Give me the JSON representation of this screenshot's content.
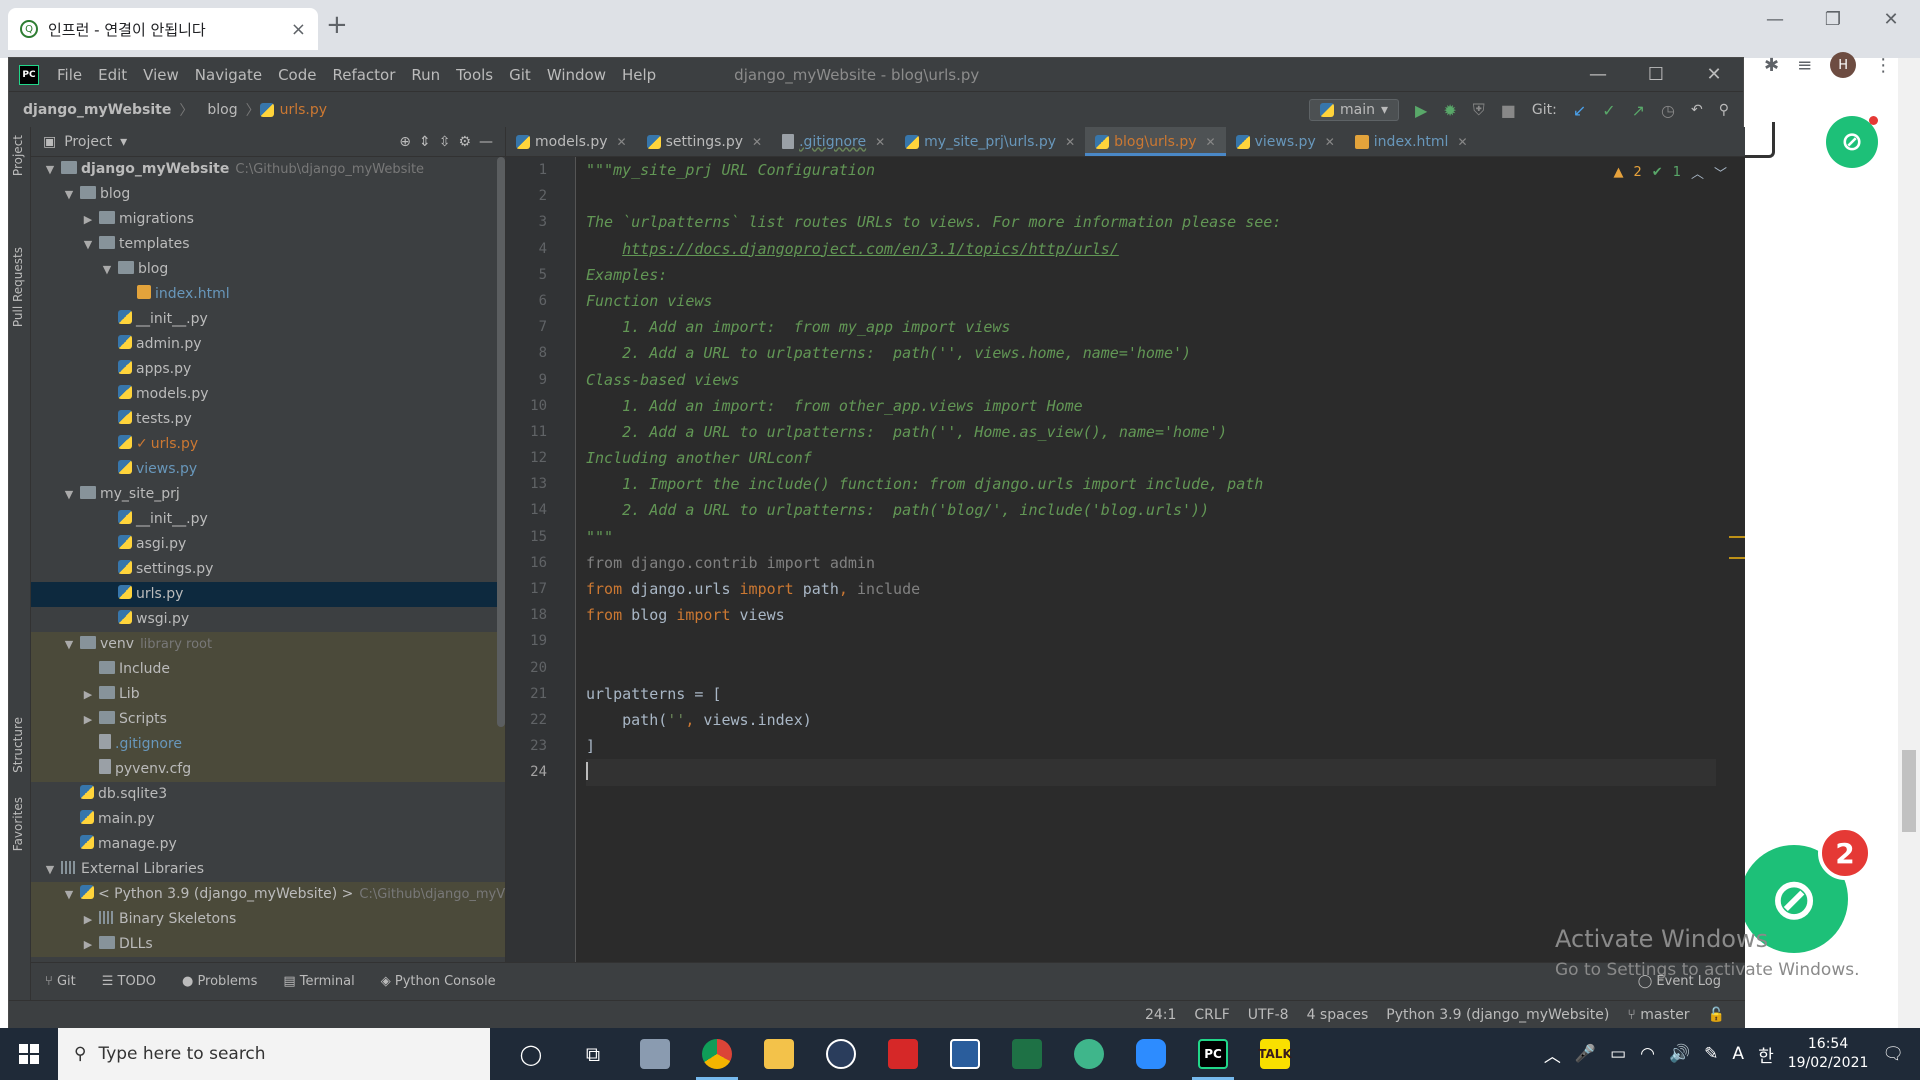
{
  "browser": {
    "tab_title": "인프런 - 연결이 안됩니다",
    "tab_close": "×",
    "new_tab": "+",
    "profile_initial": "H",
    "notif_count": "2",
    "watermark_line1": "Activate Windows",
    "watermark_line2": "Go to Settings to activate Windows."
  },
  "ide": {
    "menu": [
      "File",
      "Edit",
      "View",
      "Navigate",
      "Code",
      "Refactor",
      "Run",
      "Tools",
      "Git",
      "Window",
      "Help"
    ],
    "window_title": "django_myWebsite - blog\\urls.py",
    "breadcrumb": {
      "project": "django_myWebsite",
      "folder": "blog",
      "file": "urls.py"
    },
    "run_config": "main",
    "git_label": "Git:",
    "project_header": "Project",
    "left_strip": {
      "project": "Project",
      "pull_requests": "Pull Requests",
      "structure": "Structure",
      "favorites": "Favorites"
    },
    "tree": [
      {
        "label": "django_myWebsite",
        "extra": "C:\\Github\\django_myWebsite",
        "depth": 0,
        "arrow": "open",
        "icon": "folder",
        "bold": true
      },
      {
        "label": "blog",
        "depth": 1,
        "arrow": "open",
        "icon": "folder"
      },
      {
        "label": "migrations",
        "depth": 2,
        "arrow": "closed",
        "icon": "folder"
      },
      {
        "label": "templates",
        "depth": 2,
        "arrow": "open",
        "icon": "folder"
      },
      {
        "label": "blog",
        "depth": 3,
        "arrow": "open",
        "icon": "folder"
      },
      {
        "label": "index.html",
        "depth": 4,
        "icon": "html",
        "color": "blue"
      },
      {
        "label": "__init__.py",
        "depth": 3,
        "icon": "py"
      },
      {
        "label": "admin.py",
        "depth": 3,
        "icon": "py"
      },
      {
        "label": "apps.py",
        "depth": 3,
        "icon": "py"
      },
      {
        "label": "models.py",
        "depth": 3,
        "icon": "py"
      },
      {
        "label": "tests.py",
        "depth": 3,
        "icon": "py"
      },
      {
        "label": "urls.py",
        "depth": 3,
        "icon": "py",
        "color": "orange",
        "check": true
      },
      {
        "label": "views.py",
        "depth": 3,
        "icon": "py",
        "color": "blue"
      },
      {
        "label": "my_site_prj",
        "depth": 1,
        "arrow": "open",
        "icon": "folder"
      },
      {
        "label": "__init__.py",
        "depth": 3,
        "icon": "py"
      },
      {
        "label": "asgi.py",
        "depth": 3,
        "icon": "py"
      },
      {
        "label": "settings.py",
        "depth": 3,
        "icon": "py"
      },
      {
        "label": "urls.py",
        "depth": 3,
        "icon": "py",
        "selected": true
      },
      {
        "label": "wsgi.py",
        "depth": 3,
        "icon": "py"
      },
      {
        "label": "venv",
        "extra": "library root",
        "depth": 1,
        "arrow": "open",
        "icon": "folder",
        "venv": true
      },
      {
        "label": "Include",
        "depth": 2,
        "icon": "folder",
        "venv": true
      },
      {
        "label": "Lib",
        "depth": 2,
        "arrow": "closed",
        "icon": "folder",
        "venv": true
      },
      {
        "label": "Scripts",
        "depth": 2,
        "arrow": "closed",
        "icon": "folder",
        "venv": true
      },
      {
        "label": ".gitignore",
        "depth": 2,
        "icon": "file",
        "venv": true,
        "color": "blue"
      },
      {
        "label": "pyvenv.cfg",
        "depth": 2,
        "icon": "file",
        "venv": true
      },
      {
        "label": "db.sqlite3",
        "depth": 1,
        "icon": "py"
      },
      {
        "label": "main.py",
        "depth": 1,
        "icon": "py"
      },
      {
        "label": "manage.py",
        "depth": 1,
        "icon": "py"
      },
      {
        "label": "External Libraries",
        "depth": 0,
        "arrow": "open",
        "icon": "lib"
      },
      {
        "label": "< Python 3.9 (django_myWebsite) >",
        "extra": "C:\\Github\\django_myV",
        "depth": 1,
        "arrow": "open",
        "icon": "py",
        "venv": true
      },
      {
        "label": "Binary Skeletons",
        "depth": 2,
        "arrow": "closed",
        "icon": "lib",
        "venv": true
      },
      {
        "label": "DLLs",
        "depth": 2,
        "arrow": "closed",
        "icon": "folder",
        "venv": true
      }
    ],
    "tabs": [
      {
        "label": "models.py",
        "icon": "py"
      },
      {
        "label": "settings.py",
        "icon": "py"
      },
      {
        "label": ".gitignore",
        "icon": "file",
        "color": "blue"
      },
      {
        "label": "my_site_prj\\urls.py",
        "icon": "py",
        "color": "blue"
      },
      {
        "label": "blog\\urls.py",
        "icon": "py",
        "color": "orange",
        "active": true
      },
      {
        "label": "views.py",
        "icon": "py",
        "color": "blue"
      },
      {
        "label": "index.html",
        "icon": "html",
        "color": "blue"
      }
    ],
    "inspections": {
      "warnings": "2",
      "ok": "1"
    },
    "code": [
      [
        {
          "t": "\"\"\"my_site_prj URL Configuration",
          "c": "doc"
        }
      ],
      [],
      [
        {
          "t": "The `urlpatterns` list routes URLs to views. For more information please see:",
          "c": "doc"
        }
      ],
      [
        {
          "t": "    ",
          "c": "doc"
        },
        {
          "t": "https://docs.djangoproject.com/en/3.1/topics/http/urls/",
          "c": "doc-link"
        }
      ],
      [
        {
          "t": "Examples:",
          "c": "doc"
        }
      ],
      [
        {
          "t": "Function views",
          "c": "doc"
        }
      ],
      [
        {
          "t": "    1. Add an import:  from my_app import views",
          "c": "doc"
        }
      ],
      [
        {
          "t": "    2. Add a URL to urlpatterns:  path('', views.home, name='home')",
          "c": "doc"
        }
      ],
      [
        {
          "t": "Class-based views",
          "c": "doc"
        }
      ],
      [
        {
          "t": "    1. Add an import:  from other_app.views import Home",
          "c": "doc"
        }
      ],
      [
        {
          "t": "    2. Add a URL to urlpatterns:  path('', Home.as_view(), name='home')",
          "c": "doc"
        }
      ],
      [
        {
          "t": "Including another URLconf",
          "c": "doc"
        }
      ],
      [
        {
          "t": "    1. Import the include() function: from django.urls import include, path",
          "c": "doc"
        }
      ],
      [
        {
          "t": "    2. Add a URL to urlpatterns:  path('blog/', include('blog.urls'))",
          "c": "doc"
        }
      ],
      [
        {
          "t": "\"\"\"",
          "c": "doc"
        }
      ],
      [
        {
          "t": "from ",
          "c": "dim"
        },
        {
          "t": "django.contrib ",
          "c": "dim"
        },
        {
          "t": "import ",
          "c": "dim"
        },
        {
          "t": "admin",
          "c": "dim"
        }
      ],
      [
        {
          "t": "from ",
          "c": "kw"
        },
        {
          "t": "django.urls ",
          "c": "plain"
        },
        {
          "t": "import ",
          "c": "kw"
        },
        {
          "t": "path",
          "c": "plain"
        },
        {
          "t": ", ",
          "c": "kw"
        },
        {
          "t": "include",
          "c": "dim"
        }
      ],
      [
        {
          "t": "from ",
          "c": "kw"
        },
        {
          "t": "blog ",
          "c": "plain"
        },
        {
          "t": "import ",
          "c": "kw"
        },
        {
          "t": "views",
          "c": "plain"
        }
      ],
      [],
      [],
      [
        {
          "t": "urlpatterns = [",
          "c": "plain"
        }
      ],
      [
        {
          "t": "    path(",
          "c": "plain"
        },
        {
          "t": "''",
          "c": "str"
        },
        {
          "t": ", ",
          "c": "kw"
        },
        {
          "t": "views.index)",
          "c": "plain"
        }
      ],
      [
        {
          "t": "]",
          "c": "plain"
        }
      ],
      [
        {
          "t": "",
          "c": "caret"
        }
      ]
    ],
    "current_line": 24,
    "tool_windows": [
      "Git",
      "TODO",
      "Problems",
      "Terminal",
      "Python Console"
    ],
    "event_log": "Event Log",
    "status": [
      "24:1",
      "CRLF",
      "UTF-8",
      "4 spaces",
      "Python 3.9 (django_myWebsite)",
      "master"
    ]
  },
  "taskbar": {
    "search_placeholder": "Type here to search",
    "time": "16:54",
    "date": "19/02/2021",
    "ime_label": "A",
    "ime_label2": "한"
  }
}
